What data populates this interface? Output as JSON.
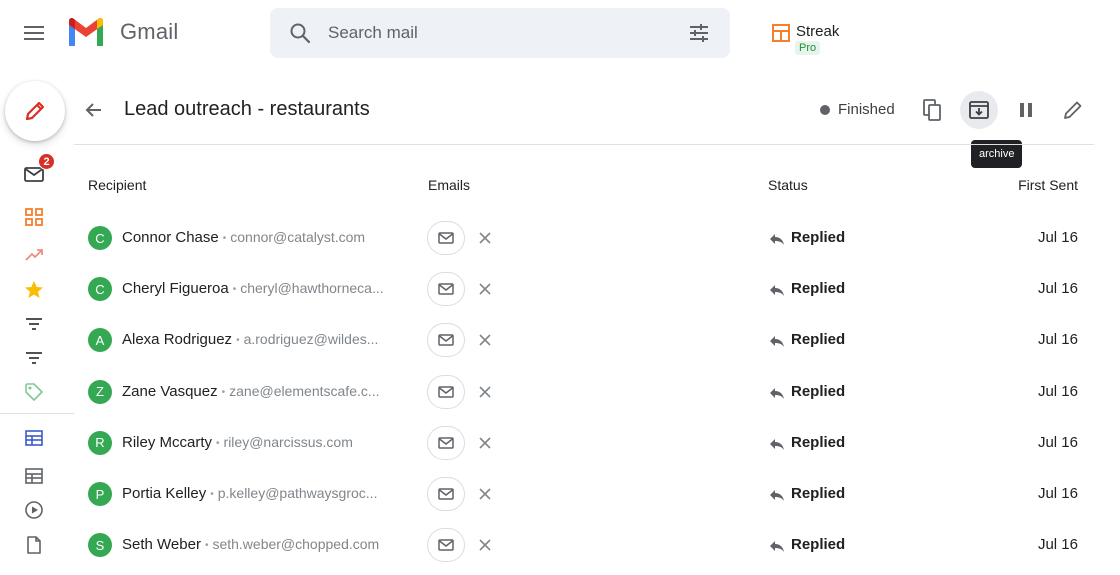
{
  "app": {
    "name": "Gmail",
    "search_placeholder": "Search mail",
    "streak_name": "Streak",
    "streak_plan": "Pro"
  },
  "sidebar": {
    "unread_badge": "2",
    "items": [
      {
        "icon": "mail-icon"
      },
      {
        "icon": "grid-icon"
      },
      {
        "icon": "trending-icon"
      },
      {
        "icon": "star-icon"
      },
      {
        "icon": "filter-icon"
      },
      {
        "icon": "filter-icon"
      },
      {
        "icon": "tag-icon"
      },
      {
        "icon": "box-icon"
      },
      {
        "icon": "box-icon"
      },
      {
        "icon": "play-icon"
      },
      {
        "icon": "document-icon"
      }
    ]
  },
  "header": {
    "title": "Lead outreach - restaurants",
    "status": "Finished",
    "tooltip": "archive"
  },
  "table": {
    "columns": [
      "Recipient",
      "Emails",
      "Status",
      "First Sent"
    ],
    "rows": [
      {
        "initial": "C",
        "name": "Connor Chase",
        "email": "connor@catalyst.com",
        "status": "Replied",
        "date": "Jul 16"
      },
      {
        "initial": "C",
        "name": "Cheryl Figueroa",
        "email": "cheryl@hawthorneca...",
        "status": "Replied",
        "date": "Jul 16"
      },
      {
        "initial": "A",
        "name": "Alexa Rodriguez",
        "email": "a.rodriguez@wildes...",
        "status": "Replied",
        "date": "Jul 16"
      },
      {
        "initial": "Z",
        "name": "Zane Vasquez",
        "email": "zane@elementscafe.c...",
        "status": "Replied",
        "date": "Jul 16"
      },
      {
        "initial": "R",
        "name": "Riley Mccarty",
        "email": "riley@narcissus.com",
        "status": "Replied",
        "date": "Jul 16"
      },
      {
        "initial": "P",
        "name": "Portia Kelley",
        "email": "p.kelley@pathwaysgroc...",
        "status": "Replied",
        "date": "Jul 16"
      },
      {
        "initial": "S",
        "name": "Seth Weber",
        "email": "seth.weber@chopped.com",
        "status": "Replied",
        "date": "Jul 16"
      }
    ]
  },
  "colors": {
    "accent_red": "#d93025",
    "avatar_green": "#34a853",
    "streak_orange": "#f4802c"
  }
}
